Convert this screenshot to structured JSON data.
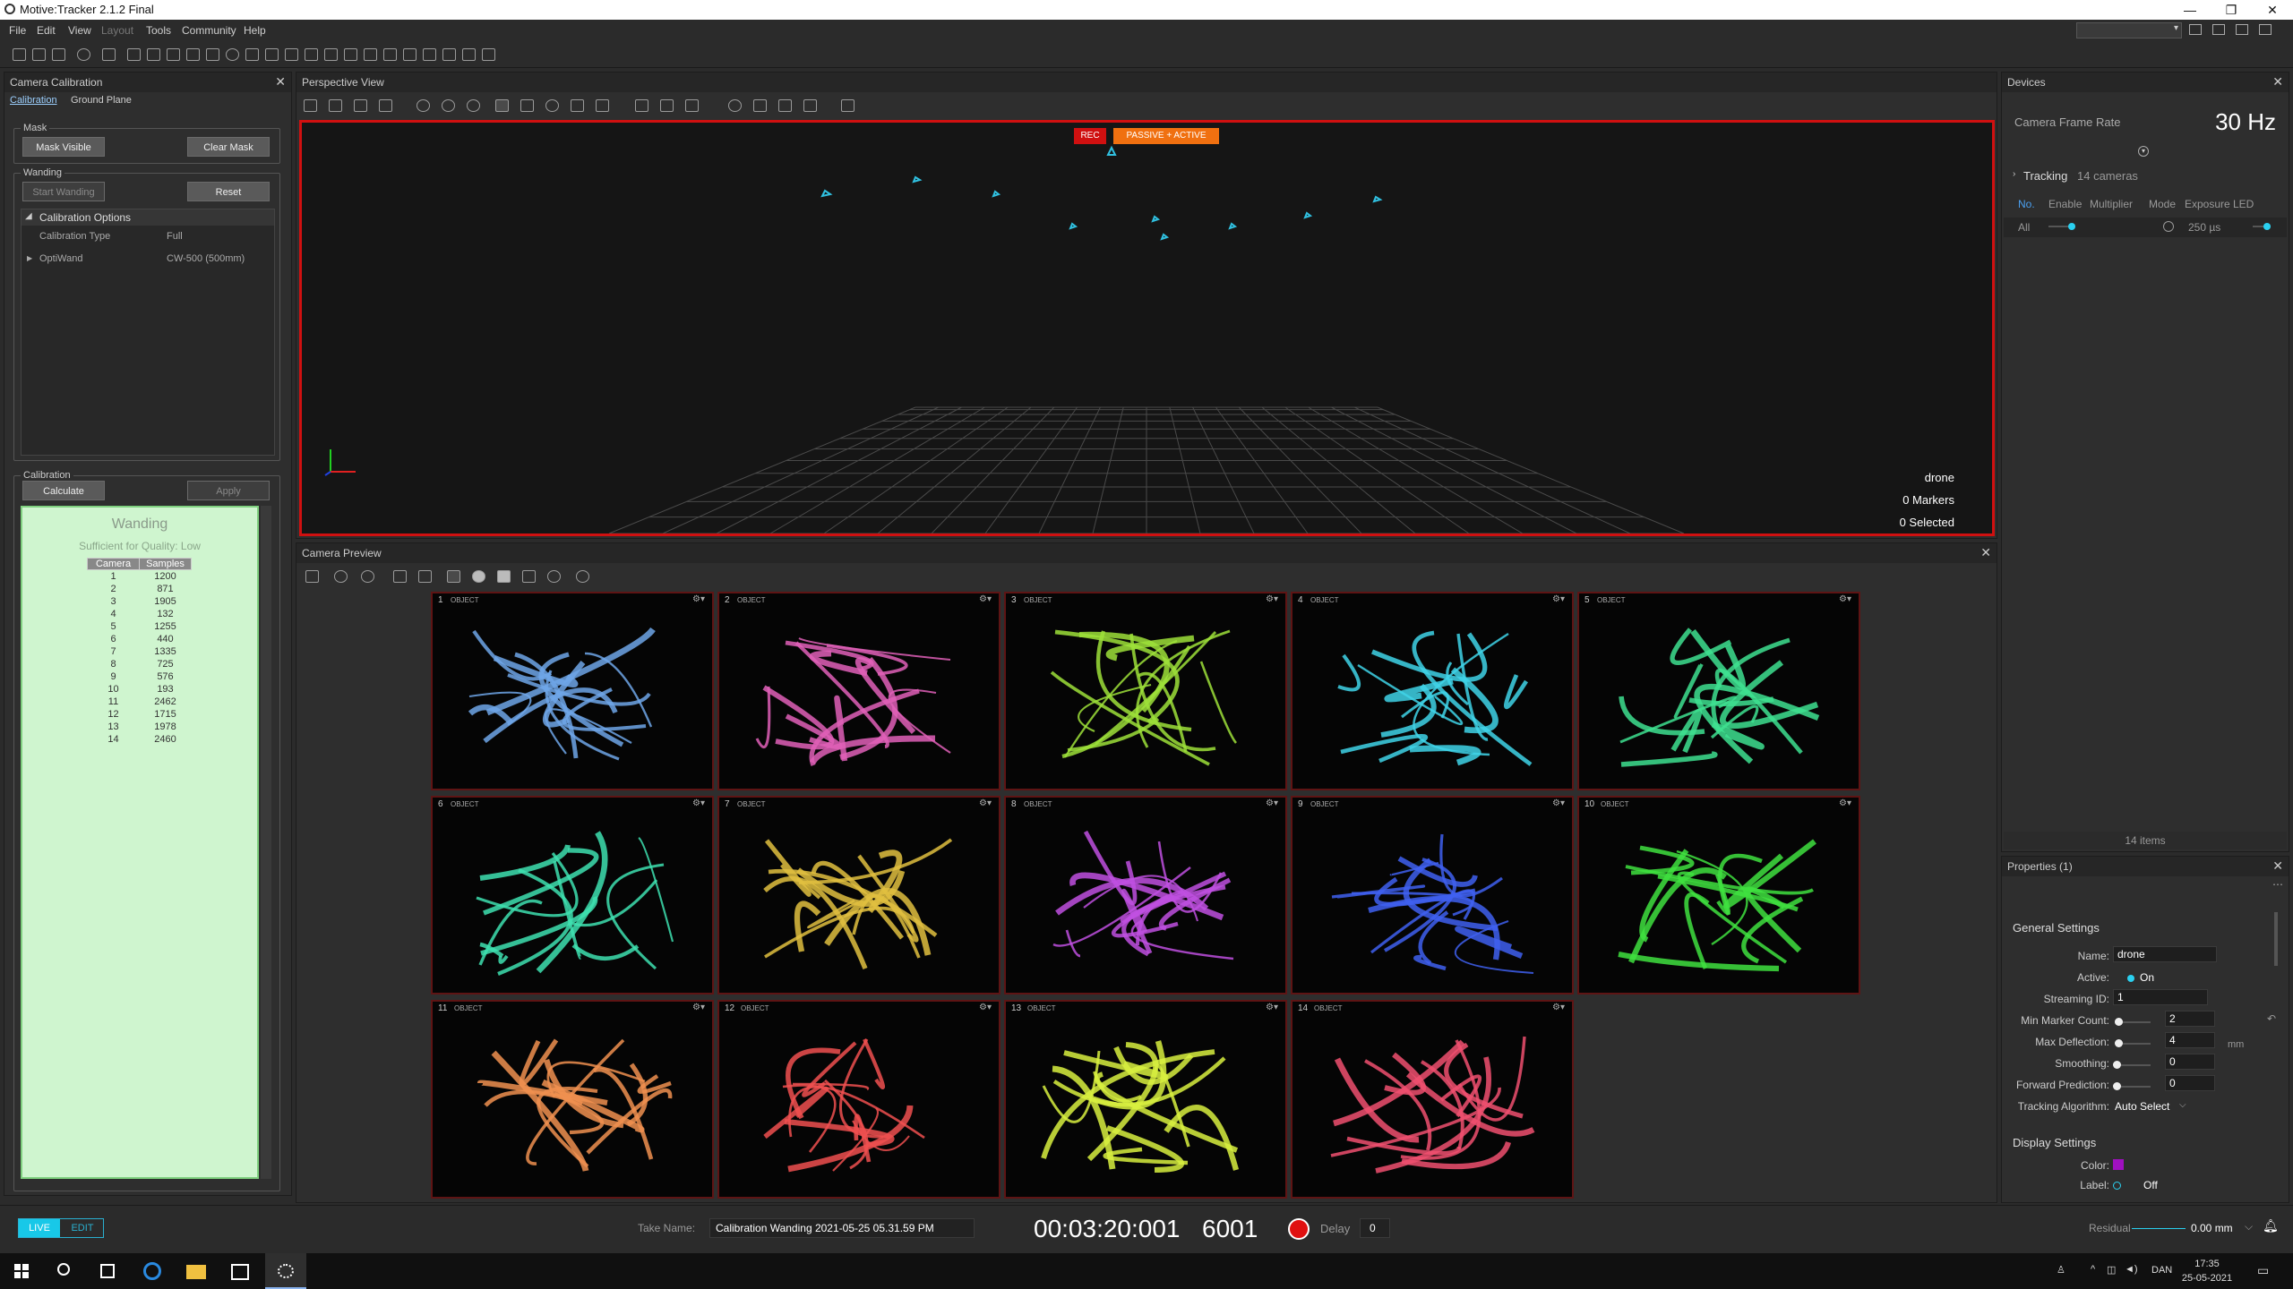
{
  "window": {
    "title": "Motive:Tracker 2.1.2 Final"
  },
  "menu": [
    "File",
    "Edit",
    "View",
    "Layout",
    "Tools",
    "Community",
    "Help"
  ],
  "camera_calibration": {
    "title": "Camera Calibration",
    "tabs": [
      "Calibration",
      "Ground Plane"
    ],
    "mask_group": "Mask",
    "mask_visible": "Mask Visible",
    "clear_mask": "Clear Mask",
    "wanding_group": "Wanding",
    "start_wanding": "Start Wanding",
    "reset": "Reset",
    "options_header": "Calibration Options",
    "calibration_type_label": "Calibration Type",
    "calibration_type_value": "Full",
    "optiwand_label": "OptiWand",
    "optiwand_value": "CW-500 (500mm)",
    "calibration_group": "Calibration",
    "calculate": "Calculate",
    "apply": "Apply",
    "wanding_title": "Wanding",
    "quality": "Sufficient for Quality: Low",
    "table_headers": [
      "Camera",
      "Samples"
    ],
    "rows": [
      [
        "1",
        "1200"
      ],
      [
        "2",
        "871"
      ],
      [
        "3",
        "1905"
      ],
      [
        "4",
        "132"
      ],
      [
        "5",
        "1255"
      ],
      [
        "6",
        "440"
      ],
      [
        "7",
        "1335"
      ],
      [
        "8",
        "725"
      ],
      [
        "9",
        "576"
      ],
      [
        "10",
        "193"
      ],
      [
        "11",
        "2462"
      ],
      [
        "12",
        "1715"
      ],
      [
        "13",
        "1978"
      ],
      [
        "14",
        "2460"
      ]
    ]
  },
  "perspective_view": {
    "title": "Perspective View",
    "rec_badge": "REC",
    "mode_badge": "PASSIVE + ACTIVE",
    "asset_name": "drone",
    "markers": "0 Markers",
    "selected": "0 Selected"
  },
  "camera_preview": {
    "title": "Camera Preview",
    "tiles": [
      {
        "num": "1",
        "mode": "OBJECT",
        "color": "#6fa6e8"
      },
      {
        "num": "2",
        "mode": "OBJECT",
        "color": "#e060b8"
      },
      {
        "num": "3",
        "mode": "OBJECT",
        "color": "#9ee03a"
      },
      {
        "num": "4",
        "mode": "OBJECT",
        "color": "#3fd4e8"
      },
      {
        "num": "5",
        "mode": "OBJECT",
        "color": "#3ee090"
      },
      {
        "num": "6",
        "mode": "OBJECT",
        "color": "#3ee0b0"
      },
      {
        "num": "7",
        "mode": "OBJECT",
        "color": "#e0c040"
      },
      {
        "num": "8",
        "mode": "OBJECT",
        "color": "#c050e0"
      },
      {
        "num": "9",
        "mode": "OBJECT",
        "color": "#4060f0"
      },
      {
        "num": "10",
        "mode": "OBJECT",
        "color": "#40e040"
      },
      {
        "num": "11",
        "mode": "OBJECT",
        "color": "#f09050"
      },
      {
        "num": "12",
        "mode": "OBJECT",
        "color": "#f05050"
      },
      {
        "num": "13",
        "mode": "OBJECT",
        "color": "#d8f040"
      },
      {
        "num": "14",
        "mode": "OBJECT",
        "color": "#f05070"
      }
    ]
  },
  "devices": {
    "title": "Devices",
    "frame_rate_label": "Camera Frame Rate",
    "frame_rate_value": "30 Hz",
    "tracking_label": "Tracking",
    "tracking_count": "14 cameras",
    "columns": [
      "No.",
      "Enable",
      "Multiplier",
      "Mode",
      "Exposure",
      "LED"
    ],
    "all_label": "All",
    "exposure_value": "250 µs",
    "items": "14 items"
  },
  "properties": {
    "title": "Properties (1)",
    "general_header": "General Settings",
    "name_label": "Name:",
    "name_value": "drone",
    "active_label": "Active:",
    "active_value": "On",
    "streaming_label": "Streaming ID:",
    "streaming_value": "1",
    "min_marker_label": "Min Marker Count:",
    "min_marker_value": "2",
    "max_deflection_label": "Max Deflection:",
    "max_deflection_value": "4",
    "max_deflection_unit": "mm",
    "smoothing_label": "Smoothing:",
    "smoothing_value": "0",
    "forward_label": "Forward Prediction:",
    "forward_value": "0",
    "algorithm_label": "Tracking Algorithm:",
    "algorithm_value": "Auto Select",
    "display_header": "Display Settings",
    "color_label": "Color:",
    "label_label": "Label:",
    "label_value": "Off"
  },
  "statusbar": {
    "live": "LIVE",
    "edit": "EDIT",
    "take_label": "Take Name:",
    "take_name": "Calibration Wanding 2021-05-25 05.31.59 PM",
    "timecode": "00:03:20:001",
    "frame": "6001",
    "delay_label": "Delay",
    "delay_value": "0",
    "residual_label": "Residual",
    "residual_value": "0.00 mm"
  },
  "taskbar": {
    "lang": "DAN",
    "time": "17:35",
    "date": "25-05-2021"
  }
}
